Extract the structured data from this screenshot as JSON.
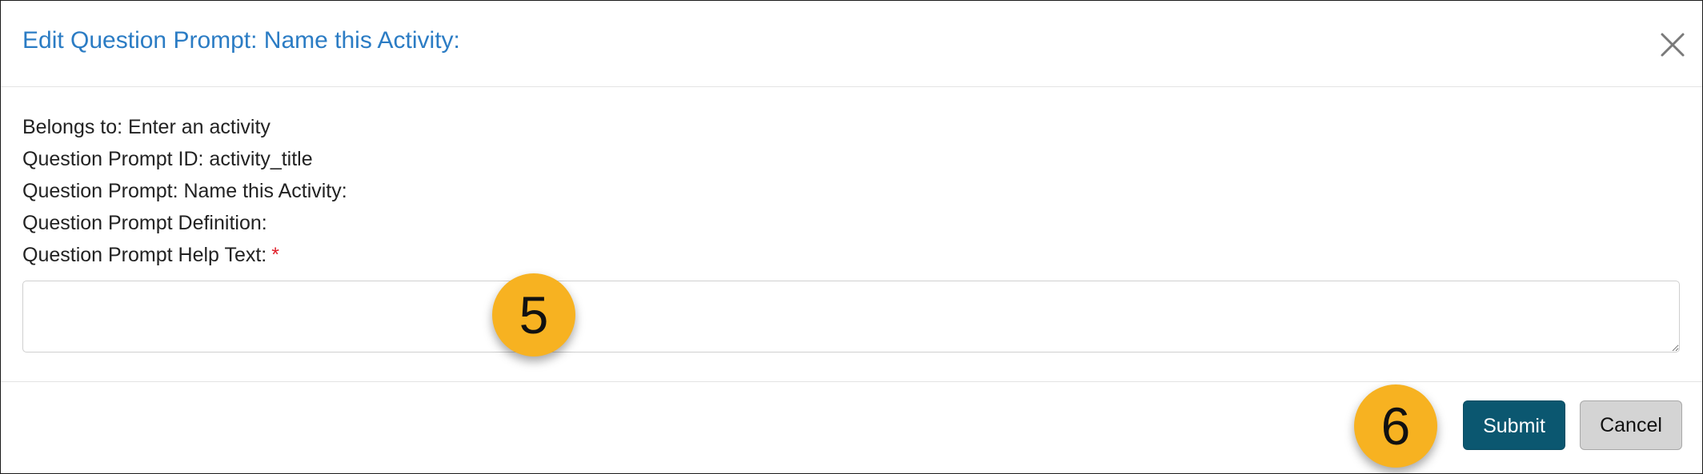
{
  "dialog": {
    "title": "Edit Question Prompt: Name this Activity:",
    "close_icon": "close-icon"
  },
  "details": {
    "belongs_to": "Belongs to: Enter an activity",
    "prompt_id": "Question Prompt ID: activity_title",
    "prompt": "Question Prompt: Name this Activity:",
    "prompt_definition": "Question Prompt Definition:",
    "help_text_label": "Question Prompt Help Text:",
    "required_marker": "*"
  },
  "help_text": {
    "value": "",
    "placeholder": ""
  },
  "footer": {
    "submit_label": "Submit",
    "cancel_label": "Cancel"
  },
  "callouts": {
    "step_5": "5",
    "step_6": "6"
  },
  "colors": {
    "title": "#2b7cc4",
    "submit_bg": "#0b5770",
    "cancel_bg": "#d4d4d4",
    "callout_bg": "#f7b221",
    "required": "#e0202a"
  }
}
